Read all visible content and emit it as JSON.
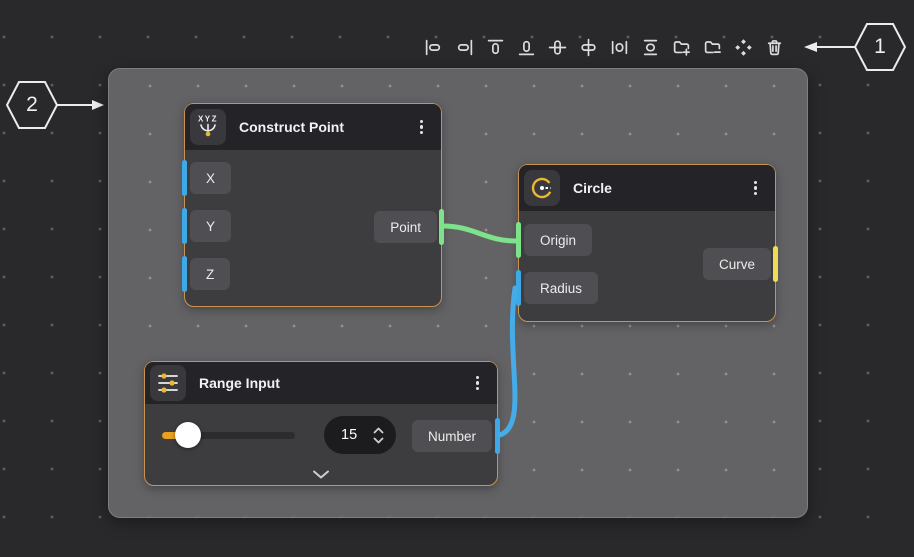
{
  "callouts": {
    "one": "1",
    "two": "2"
  },
  "toolbar": {
    "items": [
      {
        "name": "align-left",
        "icon": "align-left-icon"
      },
      {
        "name": "align-right",
        "icon": "align-right-icon"
      },
      {
        "name": "align-top",
        "icon": "align-top-icon"
      },
      {
        "name": "align-bottom",
        "icon": "align-bottom-icon"
      },
      {
        "name": "align-center-horizontal",
        "icon": "align-center-horizontal-icon"
      },
      {
        "name": "align-center-vertical",
        "icon": "align-center-vertical-icon"
      },
      {
        "name": "distribute-horizontal",
        "icon": "distribute-horizontal-icon"
      },
      {
        "name": "distribute-vertical",
        "icon": "distribute-vertical-icon"
      },
      {
        "name": "group",
        "icon": "group-icon"
      },
      {
        "name": "ungroup",
        "icon": "ungroup-icon"
      },
      {
        "name": "arrange",
        "icon": "arrange-icon"
      },
      {
        "name": "delete",
        "icon": "trash-icon"
      }
    ]
  },
  "nodes": {
    "construct_point": {
      "title": "Construct Point",
      "icon": "xyz-point-icon",
      "inputs": [
        {
          "label": "X"
        },
        {
          "label": "Y"
        },
        {
          "label": "Z"
        }
      ],
      "outputs": [
        {
          "label": "Point"
        }
      ]
    },
    "circle": {
      "title": "Circle",
      "icon": "circle-icon",
      "inputs": [
        {
          "label": "Origin"
        },
        {
          "label": "Radius"
        }
      ],
      "outputs": [
        {
          "label": "Curve"
        }
      ]
    },
    "range_input": {
      "title": "Range Input",
      "icon": "sliders-icon",
      "value": "15",
      "outputs": [
        {
          "label": "Number"
        }
      ]
    }
  },
  "colors": {
    "port_blue": "#3fa9e8",
    "port_green": "#7de28a",
    "port_yellow": "#eedc55",
    "wire_green": "#7de28a",
    "wire_blue": "#45ace8",
    "node_border": "#c79450",
    "slider_fill": "#e8a11e",
    "icon_accent_yellow": "#e8b931"
  }
}
